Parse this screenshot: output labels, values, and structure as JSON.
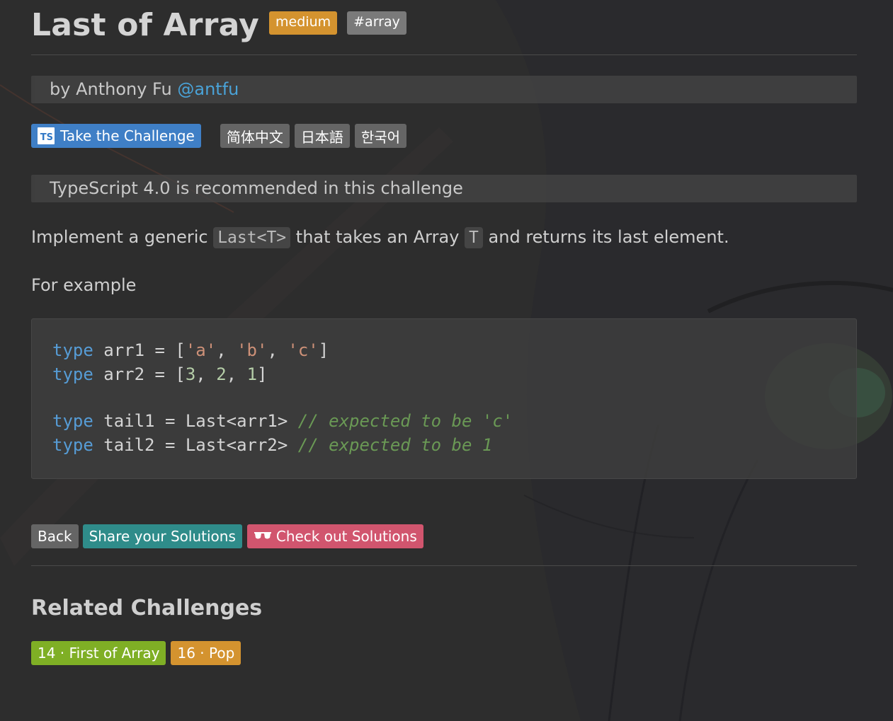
{
  "title": "Last of Array",
  "badges": {
    "difficulty": "medium",
    "tag": "#array"
  },
  "author": {
    "prefix": "by Anthony Fu",
    "handle": "@antfu"
  },
  "challenge_button": {
    "icon": "TS",
    "label": "Take the Challenge"
  },
  "languages": [
    "简体中文",
    "日本語",
    "한국어"
  ],
  "note": "TypeScript 4.0 is recommended in this challenge",
  "description": {
    "part1": "Implement a generic",
    "code1": "Last<T>",
    "part2": "that takes an Array",
    "code2": "T",
    "part3": "and returns its last element."
  },
  "example_label": "For example",
  "code_block": {
    "line1": {
      "kw": "type",
      "name": " arr1 = [",
      "a": "'a'",
      "sep1": ", ",
      "b": "'b'",
      "sep2": ", ",
      "c": "'c'",
      "end": "]"
    },
    "line2": {
      "kw": "type",
      "name": " arr2 = [",
      "n1": "3",
      "sep1": ", ",
      "n2": "2",
      "sep2": ", ",
      "n3": "1",
      "end": "]"
    },
    "line3": {
      "kw": "type",
      "rest": " tail1 = Last<arr1> ",
      "comment": "// expected to be 'c'"
    },
    "line4": {
      "kw": "type",
      "rest": " tail2 = Last<arr2> ",
      "comment": "// expected to be 1"
    }
  },
  "actions": {
    "back": "Back",
    "share": "Share your Solutions",
    "check": "Check out Solutions"
  },
  "related": {
    "title": "Related Challenges",
    "items": [
      "14 · First of Array",
      "16 · Pop"
    ]
  },
  "colors": {
    "medium": "#d4932f",
    "take_challenge": "#3f7fc6",
    "share": "#2f8c8a",
    "check": "#d1556e",
    "related_easy": "#7faf25"
  }
}
